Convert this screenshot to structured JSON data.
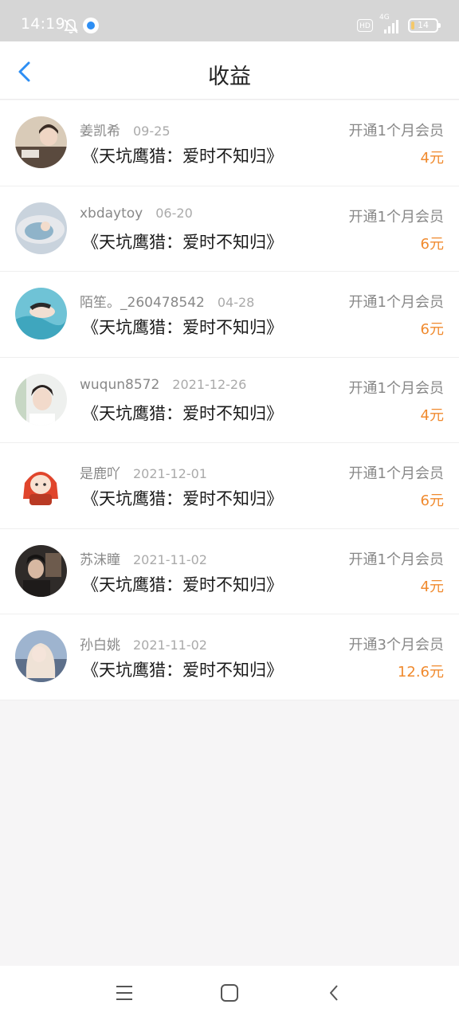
{
  "status_bar": {
    "time": "14:19",
    "hd": "HD",
    "network": "4G",
    "battery": "14",
    "battery_level": 0.14
  },
  "header": {
    "title": "收益"
  },
  "colors": {
    "accent_blue": "#2d8ef4",
    "amount_orange": "#f08a2e"
  },
  "earnings": [
    {
      "name": "姜凯希",
      "date": "09-25",
      "book": "《天坑鹰猎：爱时不知归》",
      "plan": "开通1个月会员",
      "amount": "4元"
    },
    {
      "name": "xbdaytoy",
      "date": "06-20",
      "book": "《天坑鹰猎：爱时不知归》",
      "plan": "开通1个月会员",
      "amount": "6元"
    },
    {
      "name": "陌笙。_260478542",
      "date": "04-28",
      "book": "《天坑鹰猎：爱时不知归》",
      "plan": "开通1个月会员",
      "amount": "6元"
    },
    {
      "name": "wuqun8572",
      "date": "2021-12-26",
      "book": "《天坑鹰猎：爱时不知归》",
      "plan": "开通1个月会员",
      "amount": "4元"
    },
    {
      "name": "是鹿吖",
      "date": "2021-12-01",
      "book": "《天坑鹰猎：爱时不知归》",
      "plan": "开通1个月会员",
      "amount": "6元"
    },
    {
      "name": "苏沫瞳",
      "date": "2021-11-02",
      "book": "《天坑鹰猎：爱时不知归》",
      "plan": "开通1个月会员",
      "amount": "4元"
    },
    {
      "name": "孙白姚",
      "date": "2021-11-02",
      "book": "《天坑鹰猎：爱时不知归》",
      "plan": "开通3个月会员",
      "amount": "12.6元"
    }
  ]
}
